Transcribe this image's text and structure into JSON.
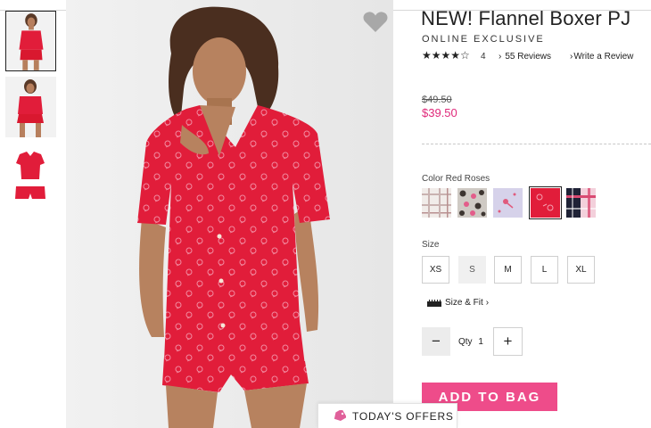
{
  "product": {
    "title": "NEW! Flannel Boxer PJ",
    "badge": "ONLINE EXCLUSIVE",
    "rating": {
      "stars_display": "★★★★☆",
      "value": "4",
      "reviews_label": "55 Reviews",
      "write_review_label": "Write a Review"
    },
    "price": {
      "original": "$49.50",
      "sale": "$39.50"
    }
  },
  "color": {
    "label": "Color Red Roses",
    "swatches": [
      "plaid-light",
      "leopard-pink",
      "lilac-print",
      "red-roses",
      "navy-plaid"
    ],
    "selected": "red-roses"
  },
  "size": {
    "label": "Size",
    "options": [
      "XS",
      "S",
      "M",
      "L",
      "XL"
    ],
    "unavailable": [
      "S"
    ],
    "fit_link": "Size & Fit"
  },
  "quantity": {
    "label": "Qty",
    "value": "1",
    "minus_symbol": "−",
    "plus_symbol": "+"
  },
  "cta": {
    "add_to_bag": "ADD TO BAG"
  },
  "offers": {
    "label": "TODAY'S OFFERS"
  },
  "colors": {
    "accent_pink": "#ee4c8a",
    "sale_price": "#e0297a",
    "product_red": "#e11d3a"
  },
  "icons": {
    "favorite": "heart-icon",
    "size_fit": "ruler-icon",
    "offers": "tag-icon"
  }
}
